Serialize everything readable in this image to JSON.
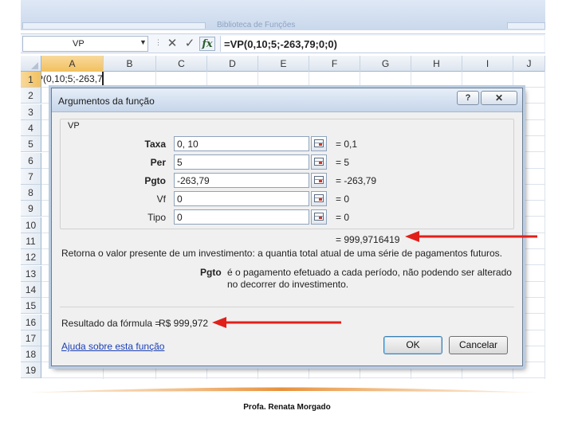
{
  "ribbon": {
    "group_label": "Biblioteca de Funções"
  },
  "formula_bar": {
    "name_box": "VP",
    "cancel_icon": "cancel-x-icon",
    "enter_icon": "check-icon",
    "fx_label": "fx",
    "formula": "=VP(0,10;5;-263,79;0;0)"
  },
  "sheet": {
    "columns": [
      "A",
      "B",
      "C",
      "D",
      "E",
      "F",
      "G",
      "H",
      "I",
      "J"
    ],
    "rows": [
      "1",
      "2",
      "3",
      "4",
      "5",
      "6",
      "7",
      "8",
      "9",
      "10",
      "11",
      "12",
      "13",
      "14",
      "15",
      "16",
      "17",
      "18",
      "19"
    ],
    "selected_column": "A",
    "selected_row": "1",
    "cell_a1": "=VP(0,10;5;-263,79;0;0)"
  },
  "dialog": {
    "title": "Argumentos da função",
    "help_button": "?",
    "close_button": "✕",
    "function_name": "VP",
    "args": [
      {
        "label": "Taxa",
        "bold": true,
        "value": "0, 10",
        "result": "=  0,1"
      },
      {
        "label": "Per",
        "bold": true,
        "value": "5",
        "result": "=  5"
      },
      {
        "label": "Pgto",
        "bold": true,
        "value": "-263,79",
        "result": "=  -263,79"
      },
      {
        "label": "Vf",
        "bold": false,
        "value": "0",
        "result": "=  0"
      },
      {
        "label": "Tipo",
        "bold": false,
        "value": "0",
        "result": "=  0"
      }
    ],
    "total_result": "=  999,9716419",
    "description": "Retorna o valor presente de um investimento: a quantia total atual de uma série de pagamentos futuros.",
    "param_name": "Pgto",
    "param_description": "é o pagamento efetuado a cada período, não podendo ser alterado no decorrer do investimento.",
    "formula_result_label": "Resultado da fórmula =",
    "formula_result_value": "R$ 999,972",
    "help_link": "Ajuda sobre esta função",
    "ok_button": "OK",
    "cancel_button": "Cancelar"
  },
  "footer": {
    "author": "Profa. Renata Morgado"
  },
  "colors": {
    "arrow": "#e0201a",
    "swoosh": "#e8913a",
    "link": "#1a3fb5"
  }
}
